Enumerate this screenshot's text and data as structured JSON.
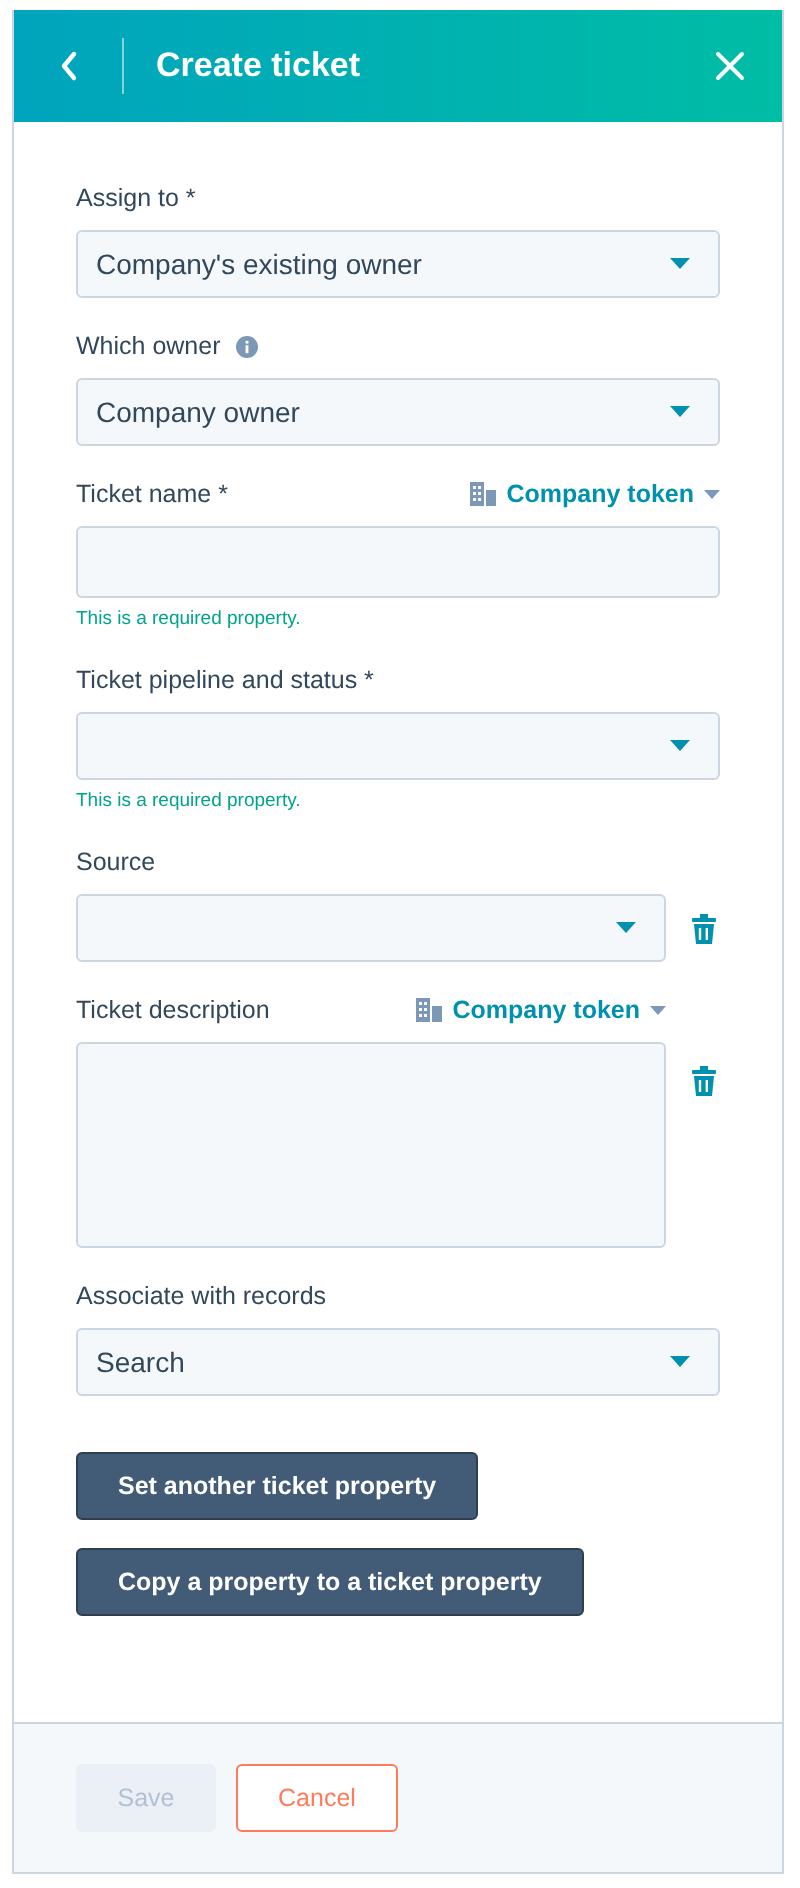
{
  "header": {
    "title": "Create ticket"
  },
  "fields": [
    {
      "kind": "select",
      "label": "Assign to *",
      "value": "Company's existing owner"
    },
    {
      "kind": "select",
      "label": "Which owner",
      "info": true,
      "value": "Company owner"
    },
    {
      "kind": "text",
      "label": "Ticket name *",
      "token_link": "Company token",
      "error": "This is a required property."
    },
    {
      "kind": "select",
      "label": "Ticket pipeline and status *",
      "error": "This is a required property."
    },
    {
      "kind": "select",
      "label": "Source",
      "removable": true
    },
    {
      "kind": "textarea",
      "label": "Ticket description",
      "token_link": "Company token",
      "removable": true
    },
    {
      "kind": "select",
      "label": "Associate with records",
      "value": "Search"
    }
  ],
  "actions": [
    "Set another ticket property",
    "Copy a property to a ticket property"
  ],
  "footer": {
    "save": {
      "label": "Save",
      "disabled": true
    },
    "cancel": {
      "label": "Cancel"
    }
  }
}
